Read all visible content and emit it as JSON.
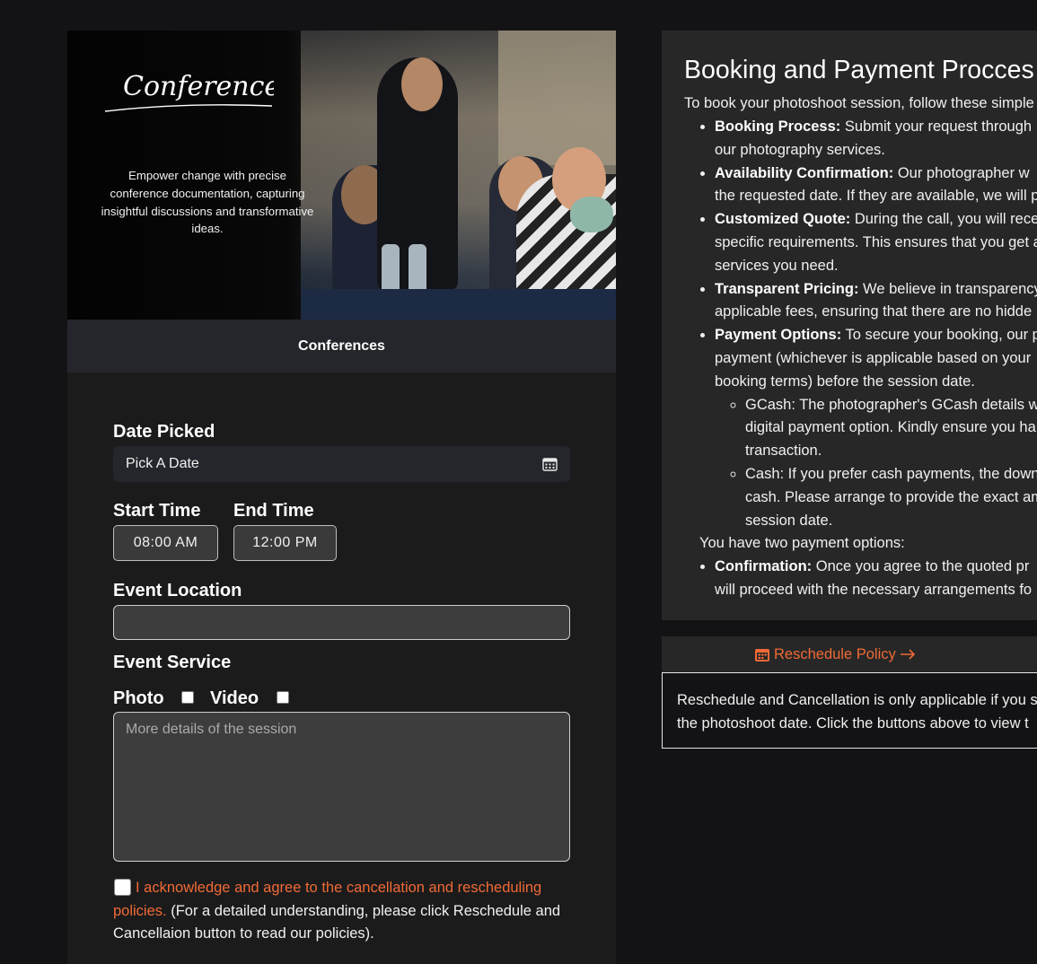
{
  "service_card": {
    "hero_title": "Conferences",
    "hero_description": "Empower change with precise conference documentation, capturing insightful discussions and transformative ideas.",
    "name": "Conferences"
  },
  "form": {
    "date_label": "Date Picked",
    "date_value": "Pick A Date",
    "start_time_label": "Start Time",
    "start_time_value": "08:00  AM",
    "end_time_label": "End Time",
    "end_time_value": "12:00  PM",
    "location_label": "Event Location",
    "location_value": "",
    "service_label": "Event Service",
    "photo_label": "Photo",
    "video_label": "Video",
    "details_placeholder": "More details of the session",
    "agree_highlight": "I acknowledge and agree to the cancellation and rescheduling policies.",
    "agree_rest": " (For a detailed understanding, please click Reschedule and Cancellaion button to read our policies)."
  },
  "info": {
    "title": "Booking and Payment Procces",
    "intro": "To book your photoshoot session, follow these simple",
    "items": [
      {
        "label": "Booking Process:",
        "lines": [
          " Submit your request through",
          "our photography services."
        ]
      },
      {
        "label": "Availability Confirmation:",
        "lines": [
          " Our photographer w",
          "the requested date. If they are available, we will p"
        ]
      },
      {
        "label": "Customized Quote:",
        "lines": [
          " During the call, you will rece",
          "specific requirements. This ensures that you get a",
          "services you need."
        ]
      },
      {
        "label": "Transparent Pricing:",
        "lines": [
          " We believe in transparency",
          "applicable fees, ensuring that there are no hidde"
        ]
      },
      {
        "label": "Payment Options:",
        "lines": [
          " To secure your booking, our p",
          "payment (whichever is applicable based on your",
          "booking terms) before the session date."
        ]
      }
    ],
    "subitems": [
      {
        "lines": [
          "GCash: The photographer's GCash details wi",
          "digital payment option. Kindly ensure you ha",
          "transaction."
        ]
      },
      {
        "lines": [
          "Cash: If you prefer cash payments, the down",
          "cash. Please arrange to provide the exact am",
          "session date."
        ]
      }
    ],
    "payment_note": "You have two payment options:",
    "confirmation": {
      "label": "Confirmation:",
      "lines": [
        " Once you agree to the quoted pr",
        "will proceed with the necessary arrangements fo"
      ]
    }
  },
  "reschedule": {
    "tab_label": "Reschedule Policy",
    "notice_lines": [
      "Reschedule and Cancellation is only applicable if you s",
      "the photoshoot date. Click the buttons above to view t"
    ]
  },
  "colors": {
    "accent": "#f06a35",
    "background": "#131315",
    "card": "#1b1b1c"
  }
}
